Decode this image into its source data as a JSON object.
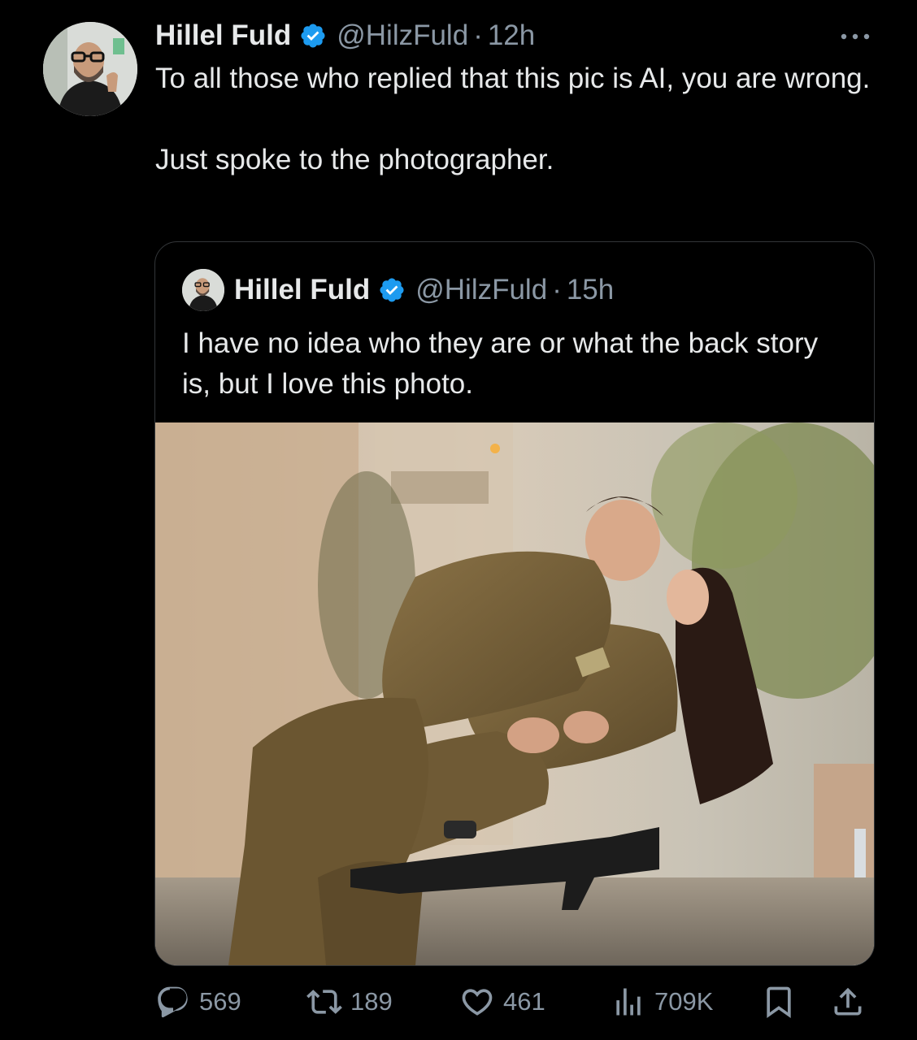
{
  "tweet": {
    "author_name": "Hillel Fuld",
    "handle": "@HilzFuld",
    "separator": "·",
    "time": "12h",
    "more_icon": "more-dots-icon",
    "paragraphs": [
      "To all those who replied that this pic is AI, you are wrong.",
      "Just spoke to the photographer."
    ]
  },
  "quoted_tweet": {
    "author_name": "Hillel Fuld",
    "handle": "@HilzFuld",
    "separator": "·",
    "time": "15h",
    "text": "I have no idea who they are or what the back story is, but I love this photo."
  },
  "actions": {
    "replies": "569",
    "retweets": "189",
    "likes": "461",
    "views": "709K"
  },
  "colors": {
    "background": "#000000",
    "text": "#e7e9ea",
    "muted": "#8b98a5",
    "verified": "#1d9bf0",
    "border": "#333639"
  }
}
